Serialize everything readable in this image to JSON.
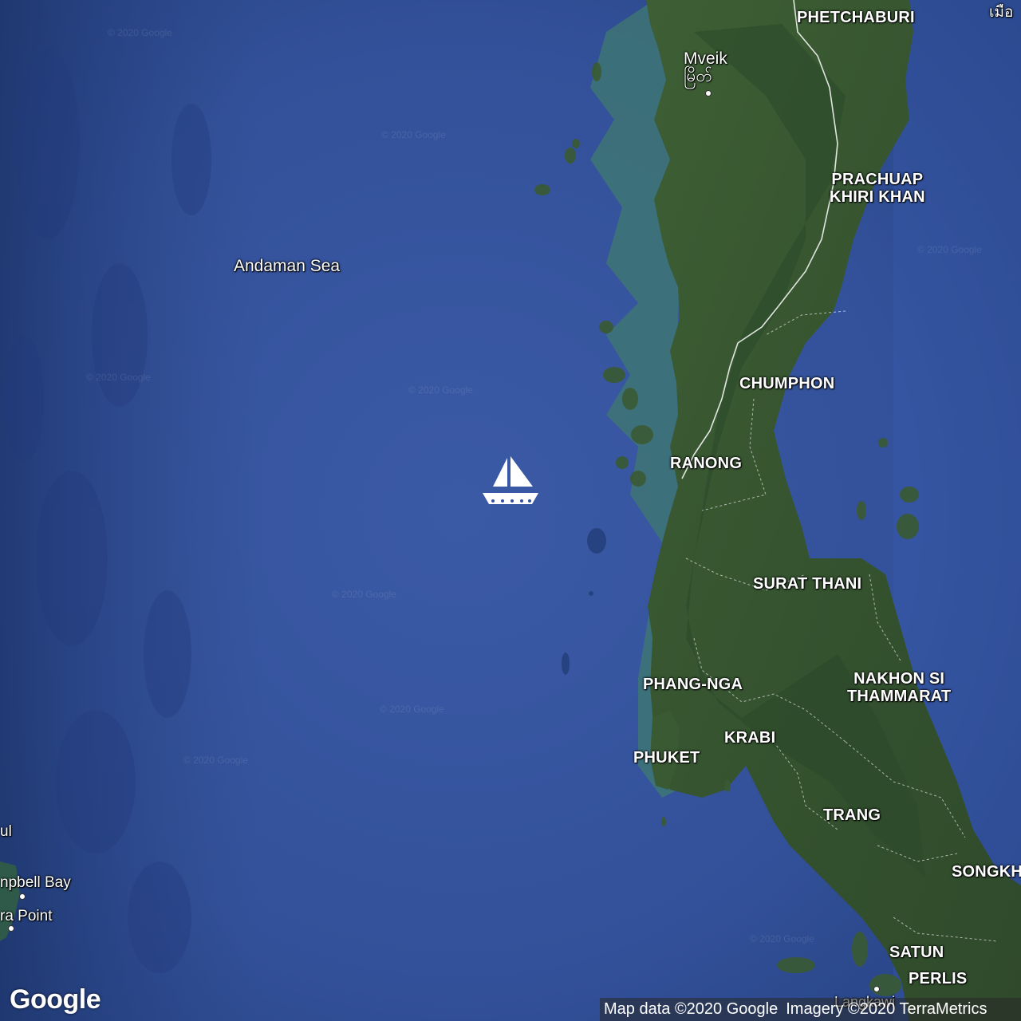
{
  "map": {
    "sea_label": "Andaman Sea",
    "provinces": [
      {
        "id": "phetchaburi",
        "name": "PHETCHABURI"
      },
      {
        "id": "prachuap",
        "name": "PRACHUAP KHIRI KHAN",
        "line1": "PRACHUAP",
        "line2": "KHIRI KHAN"
      },
      {
        "id": "chumphon",
        "name": "CHUMPHON"
      },
      {
        "id": "ranong",
        "name": "RANONG"
      },
      {
        "id": "surat-thani",
        "name": "SURAT THANI"
      },
      {
        "id": "phang-nga",
        "name": "PHANG-NGA"
      },
      {
        "id": "nakhon-si",
        "name": "NAKHON SI THAMMARAT",
        "line1": "NAKHON SI",
        "line2": "THAMMARAT"
      },
      {
        "id": "krabi",
        "name": "KRABI"
      },
      {
        "id": "phuket",
        "name": "PHUKET"
      },
      {
        "id": "trang",
        "name": "TRANG"
      },
      {
        "id": "songkhla",
        "name": "SONGKH"
      },
      {
        "id": "satun",
        "name": "SATUN"
      },
      {
        "id": "perlis",
        "name": "PERLIS"
      }
    ],
    "cities": {
      "mveik": {
        "name": "Mveik",
        "local_name": "မြိတ်"
      },
      "campbell_bay": "npbell Bay",
      "indira_point": "ra Point",
      "edge_left": "ul",
      "edge_top_right": "เมือ",
      "langkawi": "Langkawi"
    },
    "marker": {
      "icon": "sailboat-icon",
      "color": "#ffffff"
    },
    "watermark_text": "© 2020 Google",
    "colors": {
      "sea": "#2f4c8f",
      "land": "#3b5a35",
      "shallow": "#3f7a6f",
      "border": "#ffffff"
    }
  },
  "footer": {
    "logo": "Google",
    "map_data": "Map data ©2020 Google",
    "imagery": "Imagery ©2020 TerraMetrics"
  }
}
